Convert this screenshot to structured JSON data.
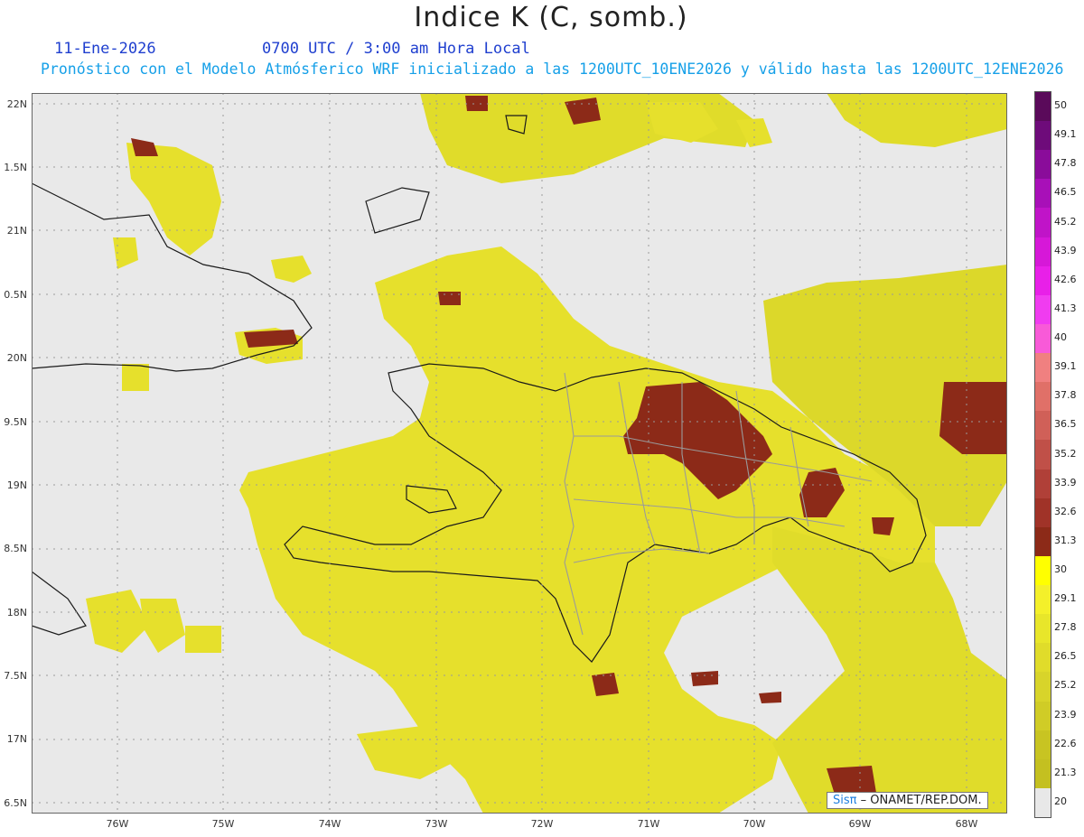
{
  "header": {
    "title": "Indice K (C, somb.)",
    "date": "11-Ene-2026",
    "time": "0700 UTC / 3:00 am Hora Local",
    "description": "Pronóstico con el Modelo Atmósferico WRF inicializado a las 1200UTC_10ENE2026 y válido hasta las  1200UTC_12ENE2026"
  },
  "axes": {
    "lat_labels": [
      "22N",
      "1.5N",
      "21N",
      "0.5N",
      "20N",
      "9.5N",
      "19N",
      "8.5N",
      "18N",
      "7.5N",
      "17N",
      "6.5N"
    ],
    "lon_labels": [
      "76W",
      "75W",
      "74W",
      "73W",
      "72W",
      "71W",
      "70W",
      "69W",
      "68W"
    ]
  },
  "colorbar": {
    "labels": [
      "50",
      "49.1",
      "47.8",
      "46.5",
      "45.2",
      "43.9",
      "42.6",
      "41.3",
      "40",
      "39.1",
      "37.8",
      "36.5",
      "35.2",
      "33.9",
      "32.6",
      "31.3",
      "30",
      "29.1",
      "27.8",
      "26.5",
      "25.2",
      "23.9",
      "22.6",
      "21.3",
      "20"
    ],
    "colors": [
      "#5a0a5a",
      "#6e0b7a",
      "#8a0c9a",
      "#a810b8",
      "#c014c8",
      "#d618d8",
      "#e820e8",
      "#f03cf0",
      "#f85ad8",
      "#f08080",
      "#e07068",
      "#d06058",
      "#c05048",
      "#b04038",
      "#a03328",
      "#8c2a18",
      "#ffff00",
      "#f4f02a",
      "#e8e62a",
      "#e0dc2a",
      "#d8d42a",
      "#d0cc26",
      "#c8c422",
      "#c4c020",
      "#e8e8e8"
    ]
  },
  "credit": {
    "brand": "Sisπ",
    "text": " – ONAMET/REP.DOM."
  }
}
